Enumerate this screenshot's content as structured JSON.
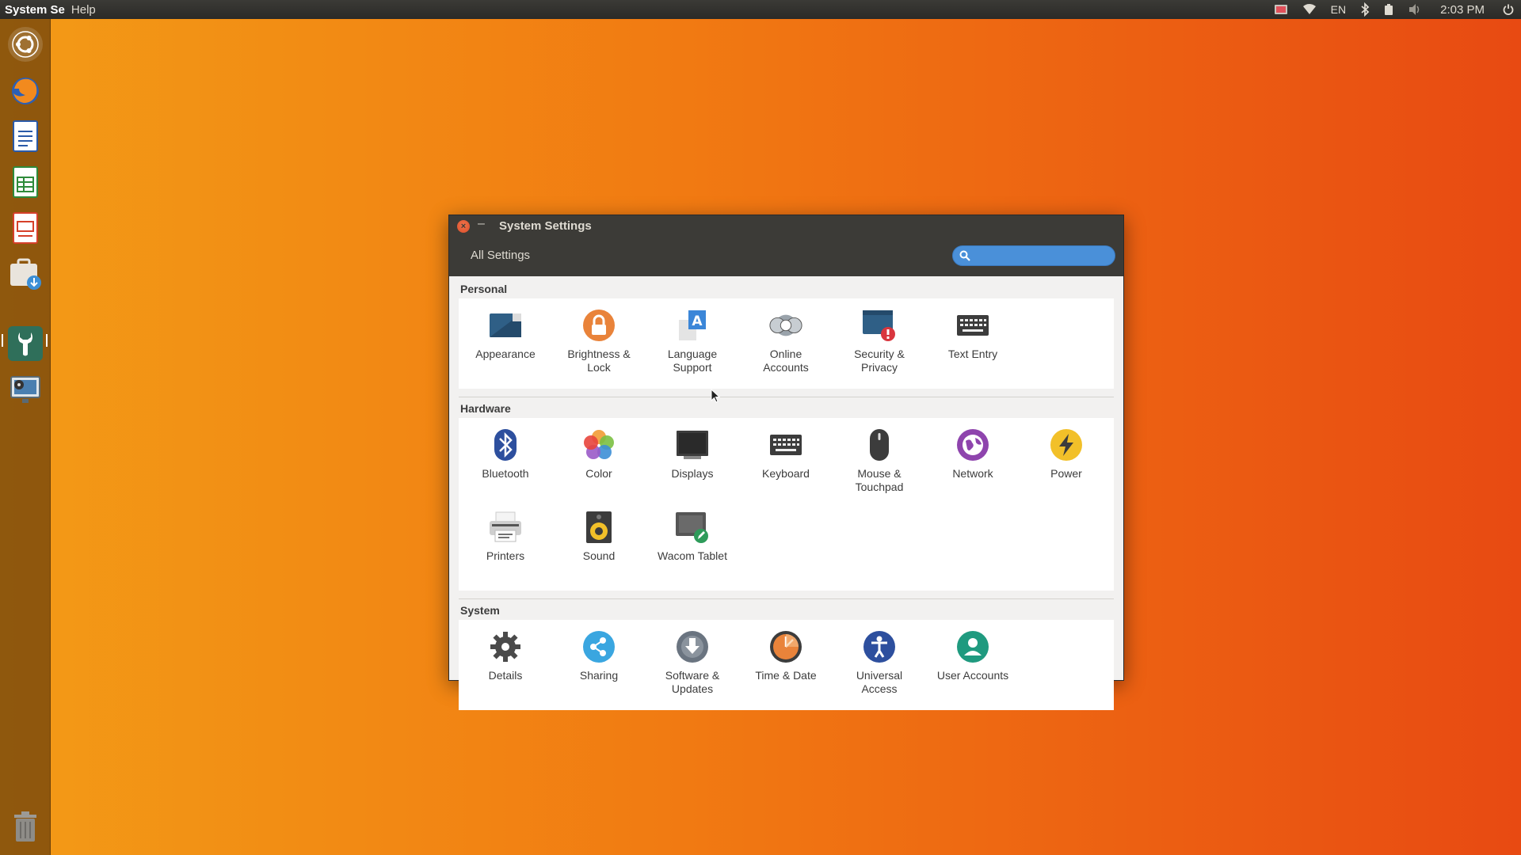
{
  "top_panel": {
    "app_name": "System Se",
    "menus": [
      "Help"
    ],
    "keyboard_layout": "EN",
    "clock": "2:03 PM"
  },
  "launcher": {
    "items": [
      {
        "name": "ubuntu-dash",
        "icon": "ubuntu-logo-icon"
      },
      {
        "name": "firefox",
        "icon": "firefox-icon"
      },
      {
        "name": "libreoffice-writer",
        "icon": "writer-icon"
      },
      {
        "name": "libreoffice-calc",
        "icon": "calc-icon"
      },
      {
        "name": "libreoffice-impress",
        "icon": "impress-icon"
      },
      {
        "name": "software-center",
        "icon": "software-center-icon"
      },
      {
        "name": "system-settings",
        "icon": "settings-icon"
      },
      {
        "name": "video-editor",
        "icon": "video-editor-icon"
      },
      {
        "name": "trash",
        "icon": "trash-icon"
      }
    ]
  },
  "window": {
    "title": "System Settings",
    "all_settings": "All Settings",
    "search_placeholder": "",
    "sections": [
      {
        "title": "Personal",
        "items": [
          {
            "label": "Appearance",
            "icon": "appearance-icon"
          },
          {
            "label": "Brightness &\nLock",
            "icon": "lock-icon"
          },
          {
            "label": "Language\nSupport",
            "icon": "language-icon"
          },
          {
            "label": "Online\nAccounts",
            "icon": "online-accounts-icon"
          },
          {
            "label": "Security &\nPrivacy",
            "icon": "security-icon"
          },
          {
            "label": "Text Entry",
            "icon": "keyboard-icon"
          }
        ]
      },
      {
        "title": "Hardware",
        "items": [
          {
            "label": "Bluetooth",
            "icon": "bluetooth-icon"
          },
          {
            "label": "Color",
            "icon": "color-icon"
          },
          {
            "label": "Displays",
            "icon": "display-icon"
          },
          {
            "label": "Keyboard",
            "icon": "keyboard-icon"
          },
          {
            "label": "Mouse &\nTouchpad",
            "icon": "mouse-icon"
          },
          {
            "label": "Network",
            "icon": "network-icon"
          },
          {
            "label": "Power",
            "icon": "power-icon"
          },
          {
            "label": "Printers",
            "icon": "printer-icon"
          },
          {
            "label": "Sound",
            "icon": "speaker-icon"
          },
          {
            "label": "Wacom Tablet",
            "icon": "tablet-icon"
          }
        ]
      },
      {
        "title": "System",
        "items": [
          {
            "label": "Details",
            "icon": "gear-icon"
          },
          {
            "label": "Sharing",
            "icon": "share-icon"
          },
          {
            "label": "Software &\nUpdates",
            "icon": "software-updates-icon"
          },
          {
            "label": "Time & Date",
            "icon": "clock-icon"
          },
          {
            "label": "Universal\nAccess",
            "icon": "accessibility-icon"
          },
          {
            "label": "User Accounts",
            "icon": "user-icon"
          }
        ]
      }
    ]
  },
  "colors": {
    "panel": "#3c3b37",
    "accent_blue": "#4a90d9",
    "close_orange": "#e95420"
  }
}
